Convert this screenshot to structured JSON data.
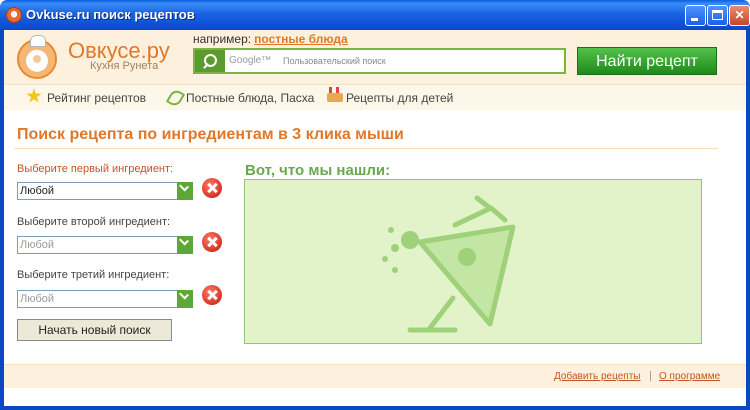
{
  "window": {
    "title": "Ovkuse.ru поиск рецептов"
  },
  "header": {
    "brand": "Овкусе.ру",
    "tagline": "Кухня Рунета",
    "example_prefix": "например:",
    "example_link": "постные блюда",
    "search": {
      "provider": "Google™",
      "placeholder": "Пользовательский поиск"
    },
    "find_button": "Найти рецепт"
  },
  "nav": [
    {
      "label": "Рейтинг рецептов",
      "icon": "star-icon"
    },
    {
      "label": "Постные блюда, Пасха",
      "icon": "leaf-icon"
    },
    {
      "label": "Рецепты для детей",
      "icon": "cake-icon"
    }
  ],
  "main": {
    "title": "Поиск рецепта по ингредиентам в 3 клика мыши",
    "ingredients": [
      {
        "label": "Выберите первый ингредиент:",
        "value": "Любой",
        "enabled": true
      },
      {
        "label": "Выберите второй ингредиент:",
        "value": "Любой",
        "enabled": false
      },
      {
        "label": "Выберите третий ингредиент:",
        "value": "Любой",
        "enabled": false
      }
    ],
    "new_search_button": "Начать новый поиск",
    "results_title": "Вот, что мы нашли:"
  },
  "footer": {
    "add_recipes": "Добавить рецепты",
    "separator": "|",
    "about": "О программе"
  },
  "colors": {
    "accent": "#e0782a",
    "green": "#6aa84f",
    "result_bg": "#e3f3c9"
  }
}
